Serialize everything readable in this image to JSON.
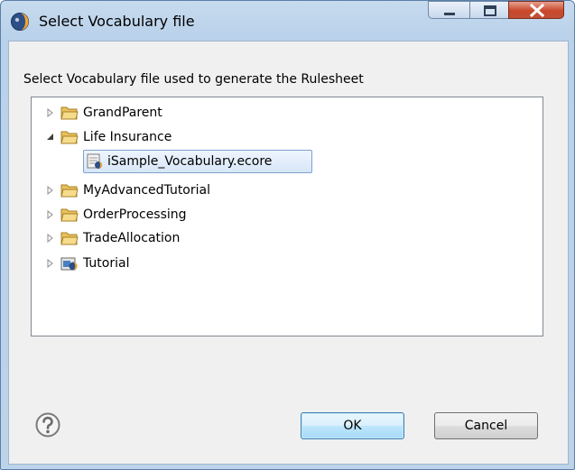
{
  "window": {
    "title": "Select Vocabulary file",
    "controls": {
      "minimize_icon": "minimize-icon",
      "maximize_icon": "maximize-icon",
      "close_icon": "close-icon"
    }
  },
  "dialog": {
    "instruction": "Select Vocabulary file used to generate the Rulesheet",
    "tree": [
      {
        "label": "GrandParent",
        "icon": "folder-icon",
        "expanded": false
      },
      {
        "label": "Life Insurance",
        "icon": "folder-icon",
        "expanded": true
      },
      {
        "label": "iSample_Vocabulary.ecore",
        "icon": "vocabulary-file-icon",
        "selected": true
      },
      {
        "label": "MyAdvancedTutorial",
        "icon": "folder-icon",
        "expanded": false
      },
      {
        "label": "OrderProcessing",
        "icon": "folder-icon",
        "expanded": false
      },
      {
        "label": "TradeAllocation",
        "icon": "folder-icon",
        "expanded": false
      },
      {
        "label": "Tutorial",
        "icon": "project-icon",
        "expanded": false
      }
    ],
    "ok_label": "OK",
    "cancel_label": "Cancel",
    "help_icon": "help-icon"
  },
  "colors": {
    "selection_border": "#7da2ce",
    "close_red": "#c9482b",
    "ok_accent": "#3c7fb1"
  }
}
